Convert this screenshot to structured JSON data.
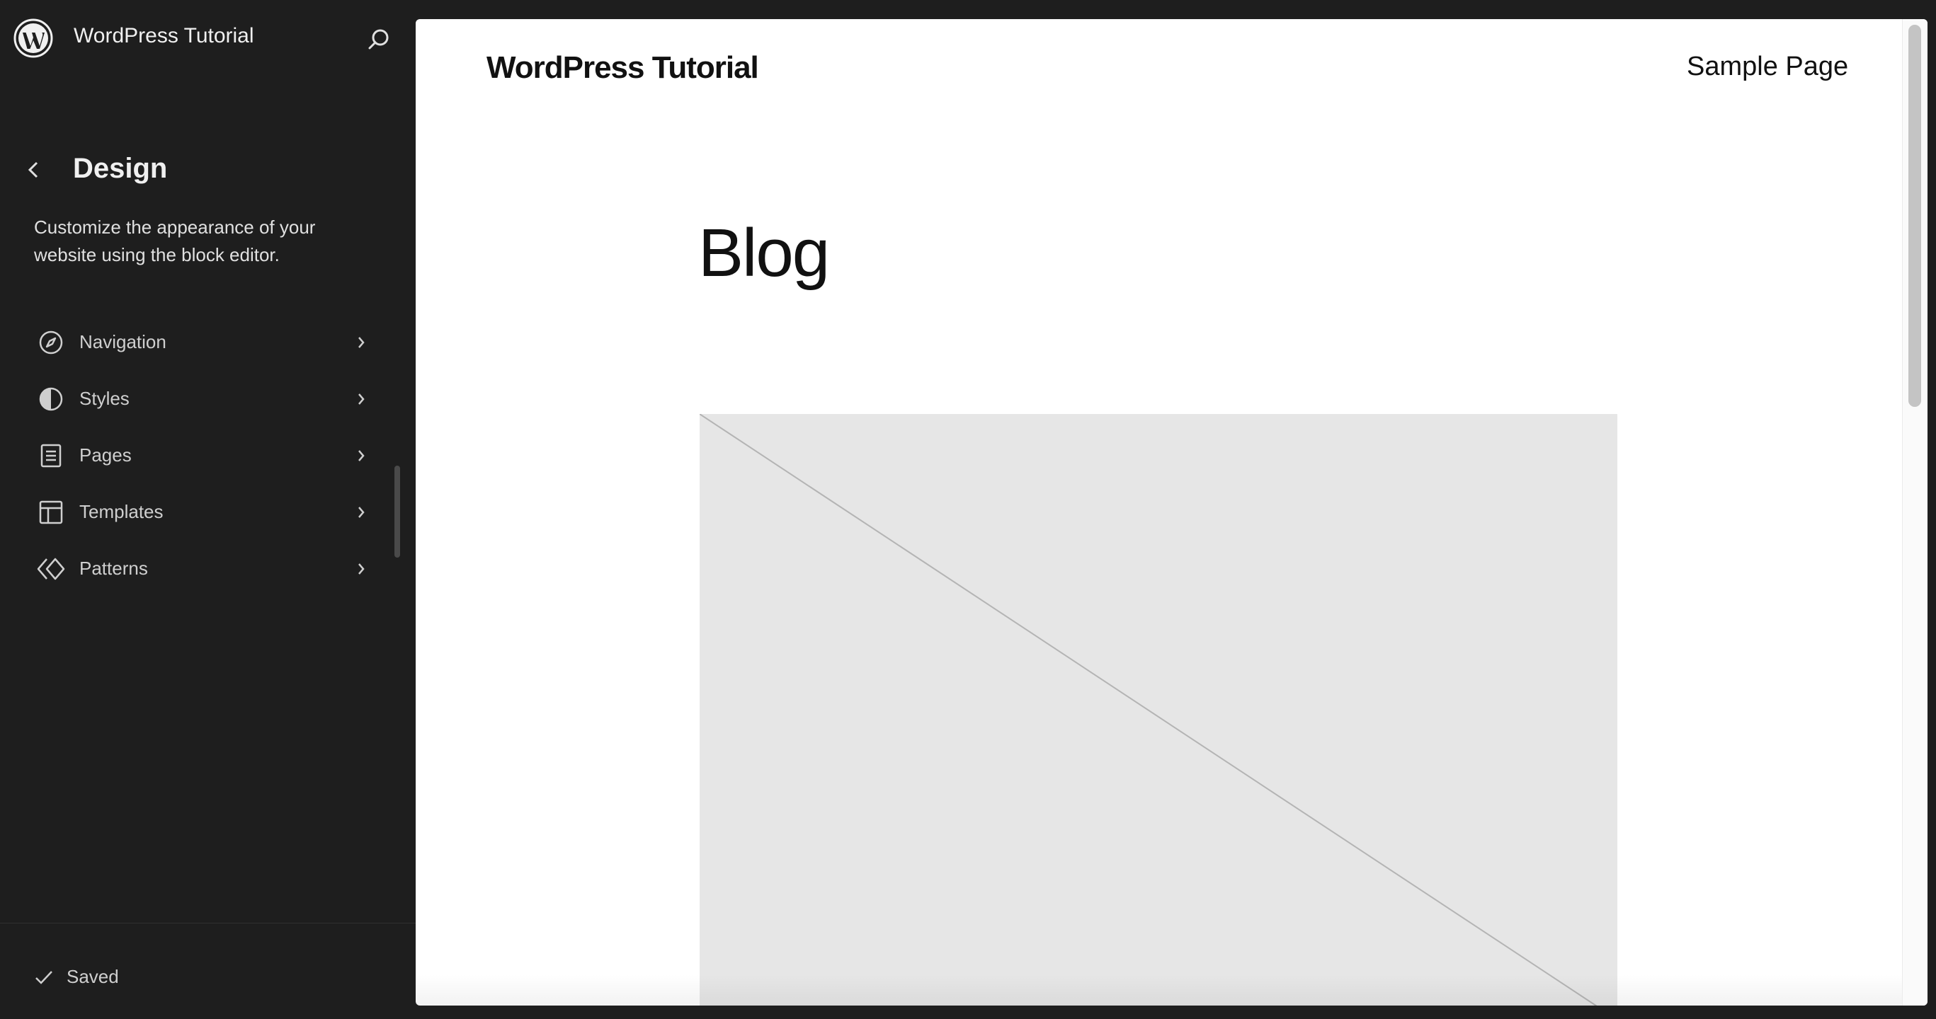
{
  "site_hub": {
    "logo_icon": "wordpress-logo-icon",
    "site_title": "WordPress Tutorial",
    "search_icon": "search-icon"
  },
  "design_panel": {
    "back_icon": "chevron-left-icon",
    "title": "Design",
    "description": "Customize the appearance of your website using the block editor.",
    "items": [
      {
        "label": "Navigation",
        "icon": "compass-icon"
      },
      {
        "label": "Styles",
        "icon": "half-circle-icon"
      },
      {
        "label": "Pages",
        "icon": "page-icon"
      },
      {
        "label": "Templates",
        "icon": "layout-icon"
      },
      {
        "label": "Patterns",
        "icon": "diamond-icon"
      }
    ]
  },
  "footer": {
    "status": "Saved",
    "status_icon": "check-icon"
  },
  "preview": {
    "site_title": "WordPress Tutorial",
    "nav_link": "Sample Page",
    "heading": "Blog",
    "image_icon": "image-placeholder-icon"
  },
  "colors": {
    "sidebar_bg": "#1e1e1e",
    "canvas_bg": "#ffffff",
    "placeholder_bg": "#e6e6e6",
    "text_light": "#e0e0e0",
    "text_dark": "#111111"
  }
}
